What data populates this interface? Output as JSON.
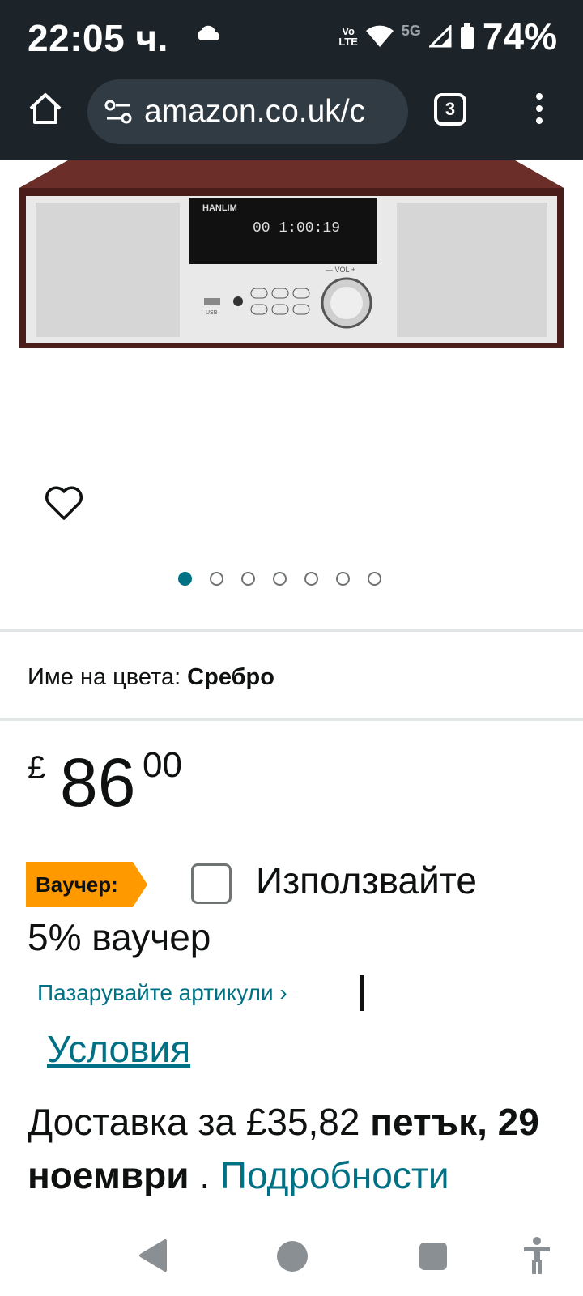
{
  "status_bar": {
    "time": "22:05 ч.",
    "volte_top": "Vo",
    "volte_bottom": "LTE",
    "network": "5G",
    "battery": "74%"
  },
  "browser": {
    "url": "amazon.co.uk/c",
    "tab_count": "3"
  },
  "product": {
    "image_brand": "HANLIM",
    "image_display": "00 1:00:19",
    "image_vol": "—  VOL  +",
    "image_usb": "USB",
    "carousel_total": 7,
    "carousel_active": 1
  },
  "color": {
    "label": "Име на цвета:",
    "value": "Сребро"
  },
  "price": {
    "currency": "£",
    "whole": "86",
    "fraction": "00"
  },
  "voucher": {
    "badge": "Ваучер:",
    "text_line1": "Използвайте",
    "text_line2": "5% ваучер",
    "shop_link": "Пазарувайте артикули ›",
    "terms_link": "Условия"
  },
  "delivery": {
    "prefix": "Доставка за £35,82 ",
    "date": "петък, 29 ноември",
    "dot": " . ",
    "details_link": "Подробности"
  },
  "colors": {
    "link": "#007185",
    "badge": "#ff9900",
    "dark_bar": "#1c2329"
  }
}
